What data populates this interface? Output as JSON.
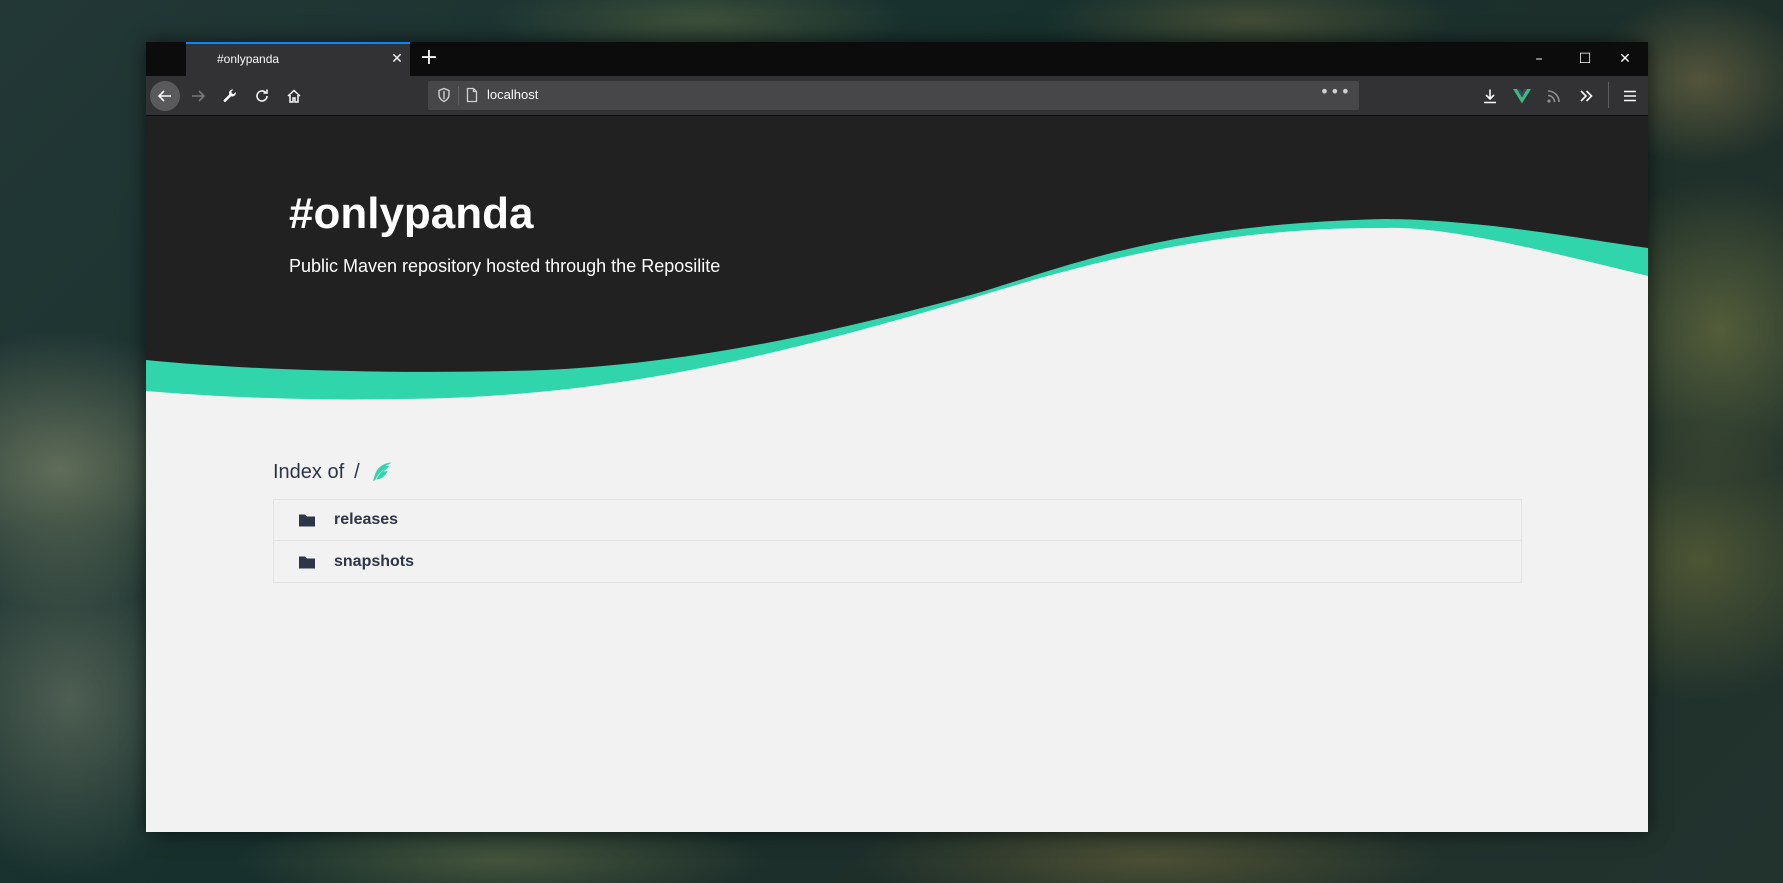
{
  "browser": {
    "tab": {
      "title": "#onlypanda",
      "close_glyph": "✕"
    },
    "new_tab_glyph": "+",
    "window_controls": {
      "minimize": "–",
      "maximize": "☐",
      "close": "✕"
    },
    "url": {
      "text": "localhost",
      "more_glyph": "•••"
    },
    "toolbar_icons": [
      "download-icon",
      "vue-devtools-icon",
      "rss-icon",
      "overflow-icon",
      "menu-icon"
    ]
  },
  "hero": {
    "title": "#onlypanda",
    "subtitle": "Public Maven repository hosted through the Reposilite"
  },
  "index": {
    "label": "Index of",
    "path": "/",
    "items": [
      {
        "name": "releases",
        "icon": "folder-icon"
      },
      {
        "name": "snapshots",
        "icon": "folder-icon"
      }
    ]
  },
  "colors": {
    "accent": "#30d5ac",
    "hero_bg": "#212121",
    "page_bg": "#f2f2f2",
    "text_dark": "#2c3648"
  }
}
